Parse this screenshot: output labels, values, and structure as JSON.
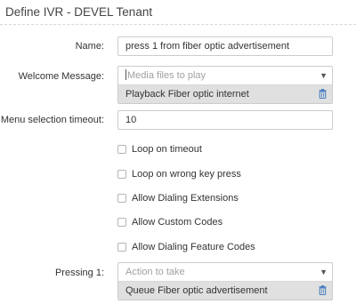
{
  "panel": {
    "title": "Define IVR - DEVEL Tenant"
  },
  "form": {
    "name": {
      "label": "Name:",
      "value": "press 1 from fiber optic advertisement"
    },
    "welcome": {
      "label": "Welcome Message:",
      "placeholder": "Media files to play",
      "selected": "Playback Fiber optic internet"
    },
    "timeout": {
      "label": "Menu selection timeout:",
      "value": "10"
    },
    "options": [
      {
        "label": "Loop on timeout",
        "checked": false
      },
      {
        "label": "Loop on wrong key press",
        "checked": false
      },
      {
        "label": "Allow Dialing Extensions",
        "checked": false
      },
      {
        "label": "Allow Custom Codes",
        "checked": false
      },
      {
        "label": "Allow Dialing Feature Codes",
        "checked": false
      }
    ],
    "pressing": {
      "label": "Pressing 1:",
      "placeholder": "Action to take",
      "selected": "Queue Fiber optic advertisement"
    }
  },
  "colors": {
    "accent_icon": "#4a7fc1",
    "chosen_bg": "#e0e0e0",
    "border": "#cccccc"
  },
  "icons": {
    "dropdown": "chevron-down-icon",
    "remove": "trash-icon"
  }
}
